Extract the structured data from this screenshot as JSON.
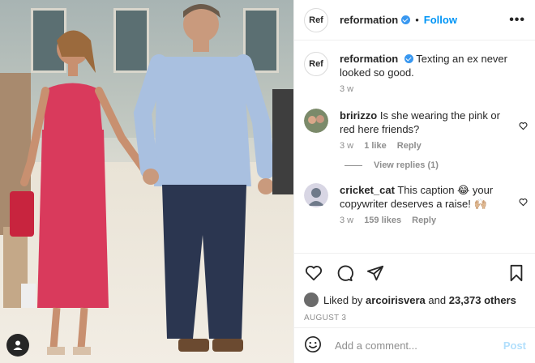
{
  "post": {
    "account": "reformation",
    "avatar_text": "Ref",
    "follow_label": "Follow",
    "separator": "•",
    "more_label": "•••"
  },
  "caption": {
    "username": "reformation",
    "text": "Texting an ex never looked so good.",
    "time": "3 w"
  },
  "comments": [
    {
      "username": "bririzzo",
      "text": "Is she wearing the pink or red here friends?",
      "time": "3 w",
      "likes": "1 like",
      "reply_label": "Reply"
    },
    {
      "username": "cricket_cat",
      "text": "This caption 😂 your copywriter deserves a raise! 🙌🏼",
      "time": "3 w",
      "likes": "159 likes",
      "reply_label": "Reply"
    }
  ],
  "view_replies_label": "View replies (1)",
  "likes_summary": {
    "prefix": "Liked by",
    "user": "arcoirisvera",
    "conjunction": "and",
    "others": "23,373 others"
  },
  "date_label": "AUGUST 3",
  "comment_box": {
    "placeholder": "Add a comment...",
    "post_label": "Post"
  },
  "colors": {
    "accent": "#0095f6",
    "verified": "#3897f0",
    "dress": "#d93a5c",
    "shirt": "#a9c0e0",
    "pants": "#2b3650"
  }
}
